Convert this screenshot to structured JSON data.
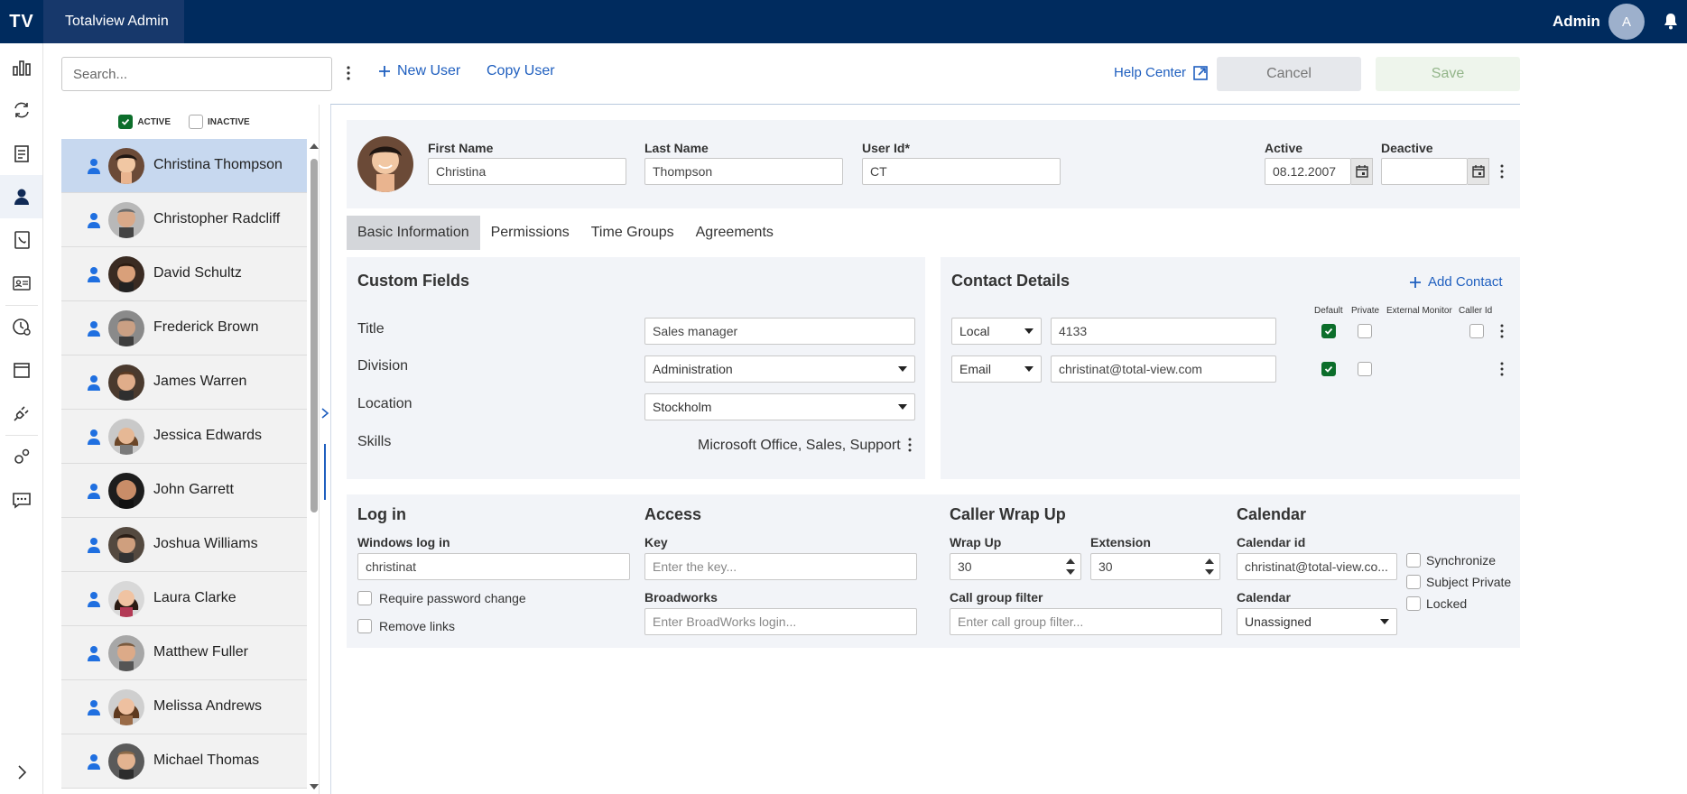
{
  "app": {
    "logo": "TV",
    "title": "Totalview Admin",
    "user_name": "Admin",
    "user_initial": "A"
  },
  "toolbar": {
    "search_placeholder": "Search...",
    "new_user": "New User",
    "copy_user": "Copy User",
    "help_center": "Help Center",
    "cancel": "Cancel",
    "save": "Save"
  },
  "filters": {
    "active": "ACTIVE",
    "inactive": "INACTIVE",
    "active_checked": true,
    "inactive_checked": false
  },
  "users": [
    {
      "name": "Christina Thompson",
      "selected": true
    },
    {
      "name": "Christopher Radcliff"
    },
    {
      "name": "David Schultz"
    },
    {
      "name": "Frederick Brown"
    },
    {
      "name": "James Warren"
    },
    {
      "name": "Jessica Edwards"
    },
    {
      "name": "John Garrett"
    },
    {
      "name": "Joshua Williams"
    },
    {
      "name": "Laura Clarke"
    },
    {
      "name": "Matthew Fuller"
    },
    {
      "name": "Melissa Andrews"
    },
    {
      "name": "Michael Thomas"
    }
  ],
  "profile": {
    "first_name_label": "First Name",
    "first_name": "Christina",
    "last_name_label": "Last Name",
    "last_name": "Thompson",
    "user_id_label": "User Id*",
    "user_id": "CT",
    "active_label": "Active",
    "active_date": "08.12.2007",
    "deactive_label": "Deactive",
    "deactive_date": ""
  },
  "tabs": [
    "Basic Information",
    "Permissions",
    "Time Groups",
    "Agreements"
  ],
  "custom_fields": {
    "title": "Custom Fields",
    "title_label": "Title",
    "title_value": "Sales manager",
    "division_label": "Division",
    "division_value": "Administration",
    "location_label": "Location",
    "location_value": "Stockholm",
    "skills_label": "Skills",
    "skills_value": "Microsoft Office, Sales, Support"
  },
  "contact": {
    "title": "Contact Details",
    "add_contact": "Add Contact",
    "headers": {
      "default": "Default",
      "private": "Private",
      "external_monitor": "External Monitor",
      "caller_id": "Caller Id"
    },
    "rows": [
      {
        "type": "Local",
        "value": "4133",
        "default": true,
        "private": false,
        "caller_id": false
      },
      {
        "type": "Email",
        "value": "christinat@total-view.com",
        "default": true,
        "private": false
      }
    ]
  },
  "login": {
    "title": "Log in",
    "windows_label": "Windows log in",
    "windows_value": "christinat",
    "require_password": "Require password change",
    "remove_links": "Remove links"
  },
  "access": {
    "title": "Access",
    "key_label": "Key",
    "key_placeholder": "Enter the key...",
    "broadworks_label": "Broadworks",
    "broadworks_placeholder": "Enter BroadWorks login..."
  },
  "wrap": {
    "title": "Caller Wrap Up",
    "wrap_label": "Wrap Up",
    "wrap_value": "30",
    "extension_label": "Extension",
    "extension_value": "30",
    "group_label": "Call group filter",
    "group_placeholder": "Enter call group filter..."
  },
  "calendar": {
    "title": "Calendar",
    "id_label": "Calendar id",
    "id_value": "christinat@total-view.co...",
    "cal_label": "Calendar",
    "cal_value": "Unassigned",
    "synchronize": "Synchronize",
    "subject_private": "Subject Private",
    "locked": "Locked"
  },
  "colors": {
    "topbar": "#002b5e",
    "accent": "#1f5fbf",
    "check": "#0c6e2b",
    "selected_row": "#c7d8ef"
  }
}
